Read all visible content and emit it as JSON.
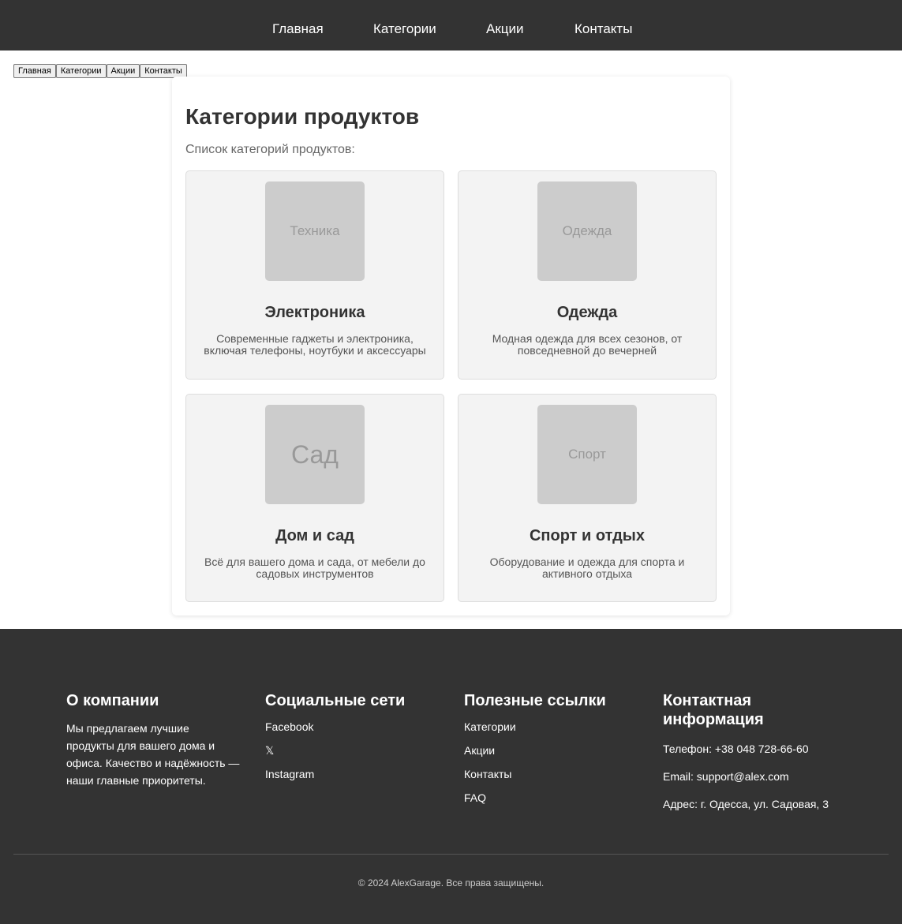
{
  "nav": {
    "items": [
      "Главная",
      "Категории",
      "Акции",
      "Контакты"
    ]
  },
  "button_bar": {
    "items": [
      "Главная",
      "Категории",
      "Акции",
      "Контакты"
    ]
  },
  "main": {
    "title": "Категории продуктов",
    "subtitle": "Список категорий продуктов:",
    "categories": [
      {
        "thumb": "Техника",
        "name": "Электроника",
        "description": "Современные гаджеты и электроника, включая телефоны, ноутбуки и аксессуары"
      },
      {
        "thumb": "Одежда",
        "name": "Одежда",
        "description": "Модная одежда для всех сезонов, от повседневной до вечерней"
      },
      {
        "thumb": "Сад",
        "name": "Дом и сад",
        "description": "Всё для вашего дома и сада, от мебели до садовых инструментов"
      },
      {
        "thumb": "Спорт",
        "name": "Спорт и отдых",
        "description": "Оборудование и одежда для спорта и активного отдыха"
      }
    ]
  },
  "footer": {
    "about": {
      "title": "О компании",
      "text": "Мы предлагаем лучшие продукты для вашего дома и офиса. Качество и надёжность — наши главные приоритеты."
    },
    "social": {
      "title": "Социальные сети",
      "links": [
        "Facebook",
        "𝕏",
        "Instagram"
      ]
    },
    "useful": {
      "title": "Полезные ссылки",
      "links": [
        "Категории",
        "Акции",
        "Контакты",
        "FAQ"
      ]
    },
    "contact": {
      "title": "Контактная информация",
      "phone": "Телефон: +38 048 728-66-60",
      "email": "Email: support@alex.com",
      "address": "Адрес: г. Одесса, ул. Садовая, 3"
    },
    "copyright": "© 2024 AlexGarage. Все права защищены."
  },
  "colors": {
    "header_bg": "#333333",
    "footer_bg": "#333333",
    "card_bg": "#f3f3f3",
    "thumb_bg": "#cccccc"
  }
}
